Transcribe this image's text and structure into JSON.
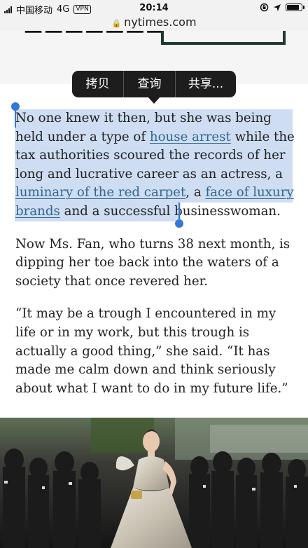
{
  "status_bar": {
    "carrier": "中国移动",
    "network": "4G",
    "vpn": "VPN",
    "time": "20:14",
    "battery_level": 0.9
  },
  "browser": {
    "url": "nytimes.com"
  },
  "context_menu": {
    "items": [
      "拷贝",
      "查询",
      "共享..."
    ]
  },
  "article": {
    "p1": {
      "t1": "No one knew it then, but she was being held under a type of ",
      "link1": "house arrest",
      "t2": " while the tax authorities scoured the records of her long and lucrative career as an actress, a ",
      "link2": "luminary of the red carpet",
      "t3": ", a ",
      "link3": "face of luxury brands",
      "t4": " and a successful businesswoman."
    },
    "p2": "Now Ms. Fan, who turns 38 next month, is dipping her toe back into the waters of a society that once revered her.",
    "p3": "“It may be a trough I encountered in my life or in my work, but this trough is actually a good thing,” she said. “It has made me calm down and think seriously about what I want to do in my future life.”"
  }
}
